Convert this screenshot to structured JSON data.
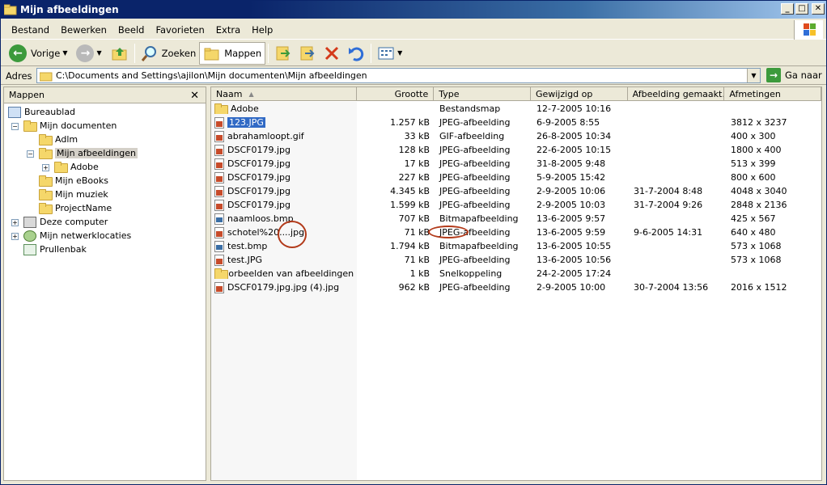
{
  "window": {
    "title": "Mijn afbeeldingen"
  },
  "menu": [
    "Bestand",
    "Bewerken",
    "Beeld",
    "Favorieten",
    "Extra",
    "Help"
  ],
  "toolbar": {
    "back": "Vorige",
    "search": "Zoeken",
    "folders": "Mappen"
  },
  "address": {
    "label": "Adres",
    "path": "C:\\Documents and Settings\\ajilon\\Mijn documenten\\Mijn afbeeldingen",
    "go": "Ga naar"
  },
  "folders_pane": {
    "title": "Mappen",
    "tree": [
      {
        "label": "Bureaublad",
        "icon": "desktop-icon"
      },
      {
        "label": "Mijn documenten",
        "icon": "documents-icon"
      },
      {
        "label": "Adlm",
        "icon": "folder-icon"
      },
      {
        "label": "Mijn afbeeldingen",
        "icon": "folder-icon"
      },
      {
        "label": "Adobe",
        "icon": "folder-icon"
      },
      {
        "label": "Mijn eBooks",
        "icon": "folder-icon"
      },
      {
        "label": "Mijn muziek",
        "icon": "folder-icon"
      },
      {
        "label": "ProjectName",
        "icon": "folder-icon"
      },
      {
        "label": "Deze computer",
        "icon": "computer-icon"
      },
      {
        "label": "Mijn netwerklocaties",
        "icon": "network-icon"
      },
      {
        "label": "Prullenbak",
        "icon": "recycle-bin-icon"
      }
    ]
  },
  "file_list": {
    "columns": [
      "Naam",
      "Grootte",
      "Type",
      "Gewijzigd op",
      "Afbeelding gemaakt…",
      "Afmetingen"
    ],
    "rows": [
      {
        "name": "Adobe",
        "size": "",
        "type": "Bestandsmap",
        "modified": "12-7-2005 10:16",
        "taken": "",
        "dims": "",
        "icon": "folder-icon"
      },
      {
        "name": "123.JPG",
        "size": "1.257 kB",
        "type": "JPEG-afbeelding",
        "modified": "6-9-2005 8:55",
        "taken": "",
        "dims": "3812 x 3237",
        "icon": "jpg-icon"
      },
      {
        "name": "abrahamloopt.gif",
        "size": "33 kB",
        "type": "GIF-afbeelding",
        "modified": "26-8-2005 10:34",
        "taken": "",
        "dims": "400 x 300",
        "icon": "jpg-icon"
      },
      {
        "name": "DSCF0179.jpg",
        "size": "128 kB",
        "type": "JPEG-afbeelding",
        "modified": "22-6-2005 10:15",
        "taken": "",
        "dims": "1800 x 400",
        "icon": "jpg-icon"
      },
      {
        "name": "DSCF0179.jpg",
        "size": "17 kB",
        "type": "JPEG-afbeelding",
        "modified": "31-8-2005 9:48",
        "taken": "",
        "dims": "513 x 399",
        "icon": "jpg-icon"
      },
      {
        "name": "DSCF0179.jpg",
        "size": "227 kB",
        "type": "JPEG-afbeelding",
        "modified": "5-9-2005 15:42",
        "taken": "",
        "dims": "800 x 600",
        "icon": "jpg-icon"
      },
      {
        "name": "DSCF0179.jpg",
        "size": "4.345 kB",
        "type": "JPEG-afbeelding",
        "modified": "2-9-2005 10:06",
        "taken": "31-7-2004 8:48",
        "dims": "4048 x 3040",
        "icon": "jpg-icon"
      },
      {
        "name": "DSCF0179.jpg",
        "size": "1.599 kB",
        "type": "JPEG-afbeelding",
        "modified": "2-9-2005 10:03",
        "taken": "31-7-2004 9:26",
        "dims": "2848 x 2136",
        "icon": "jpg-icon"
      },
      {
        "name": "naamloos.bmp",
        "size": "707 kB",
        "type": "Bitmapafbeelding",
        "modified": "13-6-2005 9:57",
        "taken": "",
        "dims": "425 x 567",
        "icon": "bmp-icon"
      },
      {
        "name": "schotel%20....jpg",
        "size": "71 kB",
        "type": "JPEG-afbeelding",
        "modified": "13-6-2005 9:59",
        "taken": "9-6-2005 14:31",
        "dims": "640 x 480",
        "icon": "jpg-icon"
      },
      {
        "name": "test.bmp",
        "size": "1.794 kB",
        "type": "Bitmapafbeelding",
        "modified": "13-6-2005 10:55",
        "taken": "",
        "dims": "573 x 1068",
        "icon": "bmp-icon"
      },
      {
        "name": "test.JPG",
        "size": "71 kB",
        "type": "JPEG-afbeelding",
        "modified": "13-6-2005 10:56",
        "taken": "",
        "dims": "573 x 1068",
        "icon": "jpg-icon"
      },
      {
        "name": "Voorbeelden van afbeeldingen",
        "size": "1 kB",
        "type": "Snelkoppeling",
        "modified": "24-2-2005 17:24",
        "taken": "",
        "dims": "",
        "icon": "shortcut-icon"
      },
      {
        "name": "DSCF0179.jpg.jpg (4).jpg",
        "size": "962 kB",
        "type": "JPEG-afbeelding",
        "modified": "2-9-2005 10:00",
        "taken": "30-7-2004 13:56",
        "dims": "2016 x 1512",
        "icon": "jpg-icon"
      }
    ],
    "selected_row": 1
  },
  "annotation_color": "#b23a1a"
}
